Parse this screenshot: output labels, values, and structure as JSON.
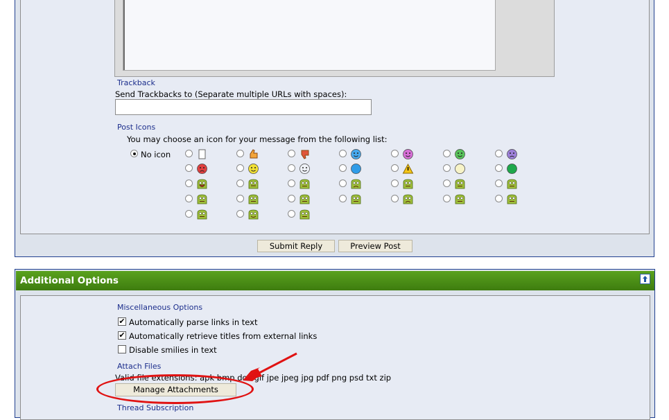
{
  "trackback": {
    "title": "Trackback",
    "label": "Send Trackbacks to (Separate multiple URLs with spaces):",
    "value": ""
  },
  "post_icons": {
    "title": "Post Icons",
    "instruction": "You may choose an icon for your message from the following list:",
    "no_icon_label": "No icon",
    "selected": "no-icon",
    "icons": [
      [
        "page",
        "thumbs-up",
        "thumbs-down",
        "smile",
        "tongue",
        "grin",
        "sad"
      ],
      [
        "angry",
        "happy",
        "cool",
        "question",
        "warning",
        "lightbulb",
        "arrow-right"
      ],
      [
        "droid-shout",
        "droid-money",
        "droid-confused",
        "droid-frown",
        "droid-shock",
        "droid-tongue",
        "droid-wink"
      ],
      [
        "droid-gasp",
        "droid-kiss",
        "droid-neutral",
        "droid-grimace",
        "droid-cry",
        "droid-shades",
        "droid-monocle"
      ],
      [
        "droid-annoyed",
        "droid-love",
        "droid-zipper"
      ]
    ]
  },
  "buttons": {
    "submit_reply": "Submit Reply",
    "preview_post": "Preview Post"
  },
  "additional_options": {
    "title": "Additional Options",
    "misc": {
      "title": "Miscellaneous Options",
      "options": [
        {
          "label": "Automatically parse links in text",
          "checked": true
        },
        {
          "label": "Automatically retrieve titles from external links",
          "checked": true
        },
        {
          "label": "Disable smilies in text",
          "checked": false
        }
      ]
    },
    "attach": {
      "title": "Attach Files",
      "extensions_text": "Valid file extensions: apk bmp doc gif jpe jpeg jpg pdf png psd txt zip",
      "manage_button": "Manage Attachments"
    },
    "subscription_title": "Thread Subscription"
  },
  "colors": {
    "header_green": "#4e9419",
    "section_title_blue": "#1c2e8c",
    "annotation_red": "#e01212"
  }
}
